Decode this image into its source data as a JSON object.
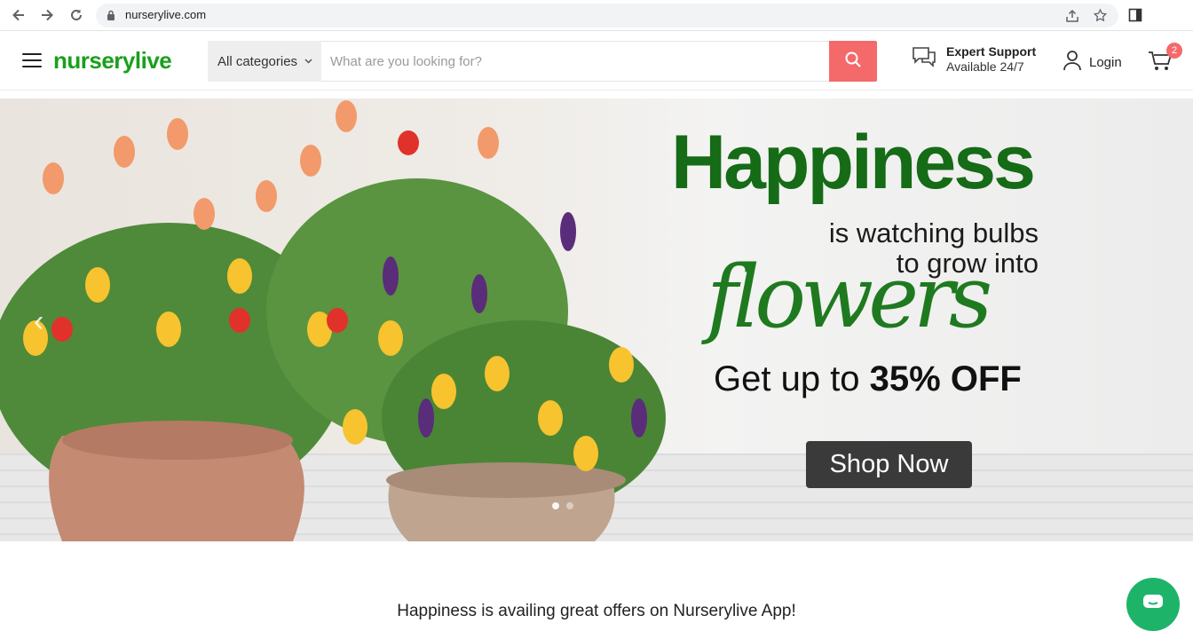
{
  "browser": {
    "url": "nurserylive.com"
  },
  "header": {
    "logo_part1": "nursery",
    "logo_part2": "live",
    "category_label": "All categories",
    "search_placeholder": "What are you looking for?",
    "support_title": "Expert Support",
    "support_subtitle": "Available 24/7",
    "login_label": "Login",
    "cart_count": "2"
  },
  "hero": {
    "headline": "Happiness",
    "line2": "is watching bulbs",
    "line3": "to grow into",
    "script_word": "flowers",
    "offer_prefix": "Get up to ",
    "offer_bold": "35% OFF",
    "cta_label": "Shop Now"
  },
  "promo": {
    "text": "Happiness is availing great offers on Nurserylive App!"
  },
  "colors": {
    "brand_green": "#1aa01c",
    "accent_red": "#f46a6a",
    "chat_green": "#1db469"
  }
}
